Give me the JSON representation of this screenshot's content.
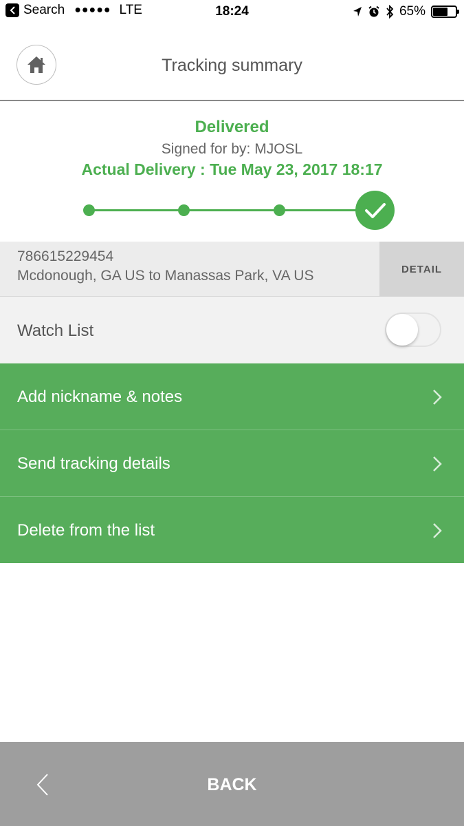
{
  "status_bar": {
    "back_app": "Search",
    "signal": "●●●●●",
    "carrier": "LTE",
    "time": "18:24",
    "battery": "65%",
    "battery_level": 0.65
  },
  "header": {
    "title": "Tracking summary",
    "home_icon": "home-icon"
  },
  "summary": {
    "status": "Delivered",
    "signed_for": "Signed for by: MJOSL",
    "actual_delivery": "Actual Delivery : Tue May 23, 2017 18:17",
    "progress_steps": 4,
    "completed_steps": 4
  },
  "tracking": {
    "number": "786615229454",
    "route": "Mcdonough, GA US to Manassas Park, VA US",
    "detail_label": "DETAIL"
  },
  "watch_list": {
    "label": "Watch List",
    "enabled": false
  },
  "actions": [
    {
      "label": "Add nickname & notes"
    },
    {
      "label": "Send tracking details"
    },
    {
      "label": "Delete from the list"
    }
  ],
  "footer": {
    "back_label": "BACK"
  },
  "colors": {
    "accent_green": "#4caf50",
    "action_green": "#57ad5b",
    "footer_gray": "#9e9e9e"
  }
}
